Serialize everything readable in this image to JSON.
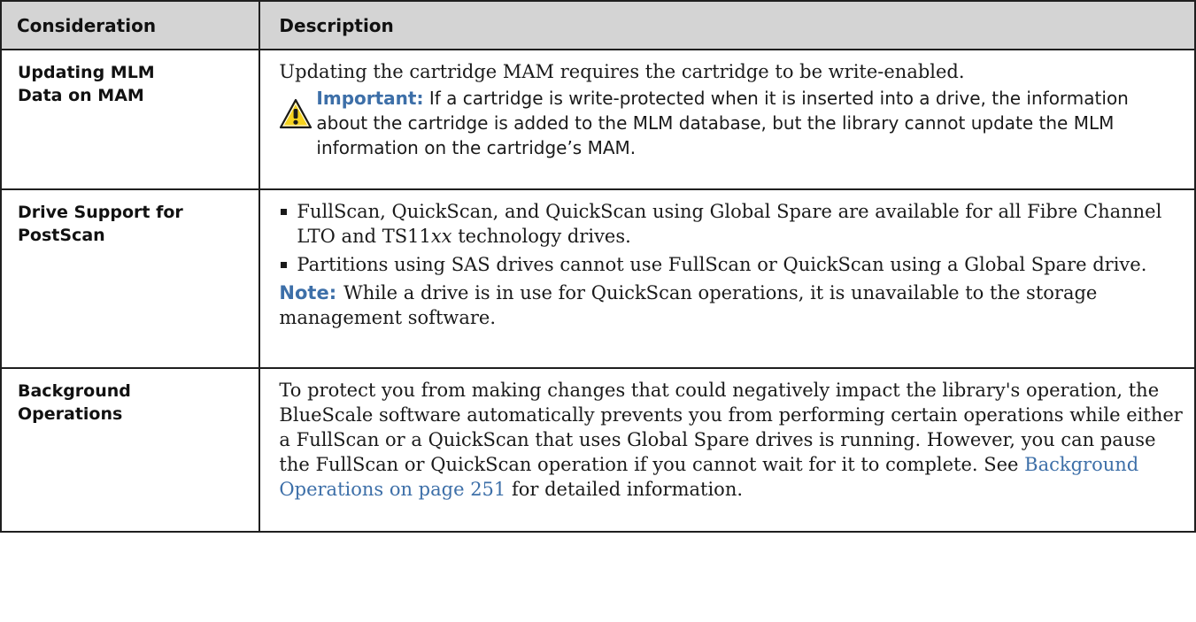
{
  "table": {
    "header": {
      "consideration": "Consideration",
      "description": "Description"
    },
    "rows": [
      {
        "title_line1": "Updating MLM",
        "title_line2": "Data on MAM",
        "text": "Updating the cartridge MAM requires the cartridge to be write-enabled.",
        "important_label": "Important:",
        "important_text": " If a cartridge is write-protected when it is inserted into a drive, the information about the cartridge is added to the MLM database, but the library cannot update the MLM information on the cartridge’s MAM."
      },
      {
        "title_line1": "Drive Support for",
        "title_line2": "PostScan",
        "bullet1_a": "FullScan, QuickScan, and QuickScan using Global Spare are available for all Fibre Channel LTO and TS11",
        "bullet1_var": "xx",
        "bullet1_b": " technology drives.",
        "bullet2": "Partitions using SAS drives cannot use FullScan or QuickScan using a Global Spare drive.",
        "note_label": "Note:",
        "note_text": "While a drive is in use for QuickScan operations, it is unavailable to the storage management software."
      },
      {
        "title_line1": "Background",
        "title_line2": "Operations",
        "text": "To protect you from making changes that could negatively impact the library's operation, the BlueScale software automatically prevents you from performing certain operations while either a FullScan or a QuickScan that uses Global Spare drives is running. However, you can pause the FullScan or QuickScan operation if you cannot wait for it to complete. See ",
        "link_text": "Background Operations on page 251",
        "text_after": " for detailed information."
      }
    ]
  },
  "colors": {
    "header_bg": "#d4d4d4",
    "accent_blue": "#3d6fa8",
    "icon_yellow": "#f5d21e"
  },
  "icons": {
    "warning": "warning-triangle-icon"
  }
}
